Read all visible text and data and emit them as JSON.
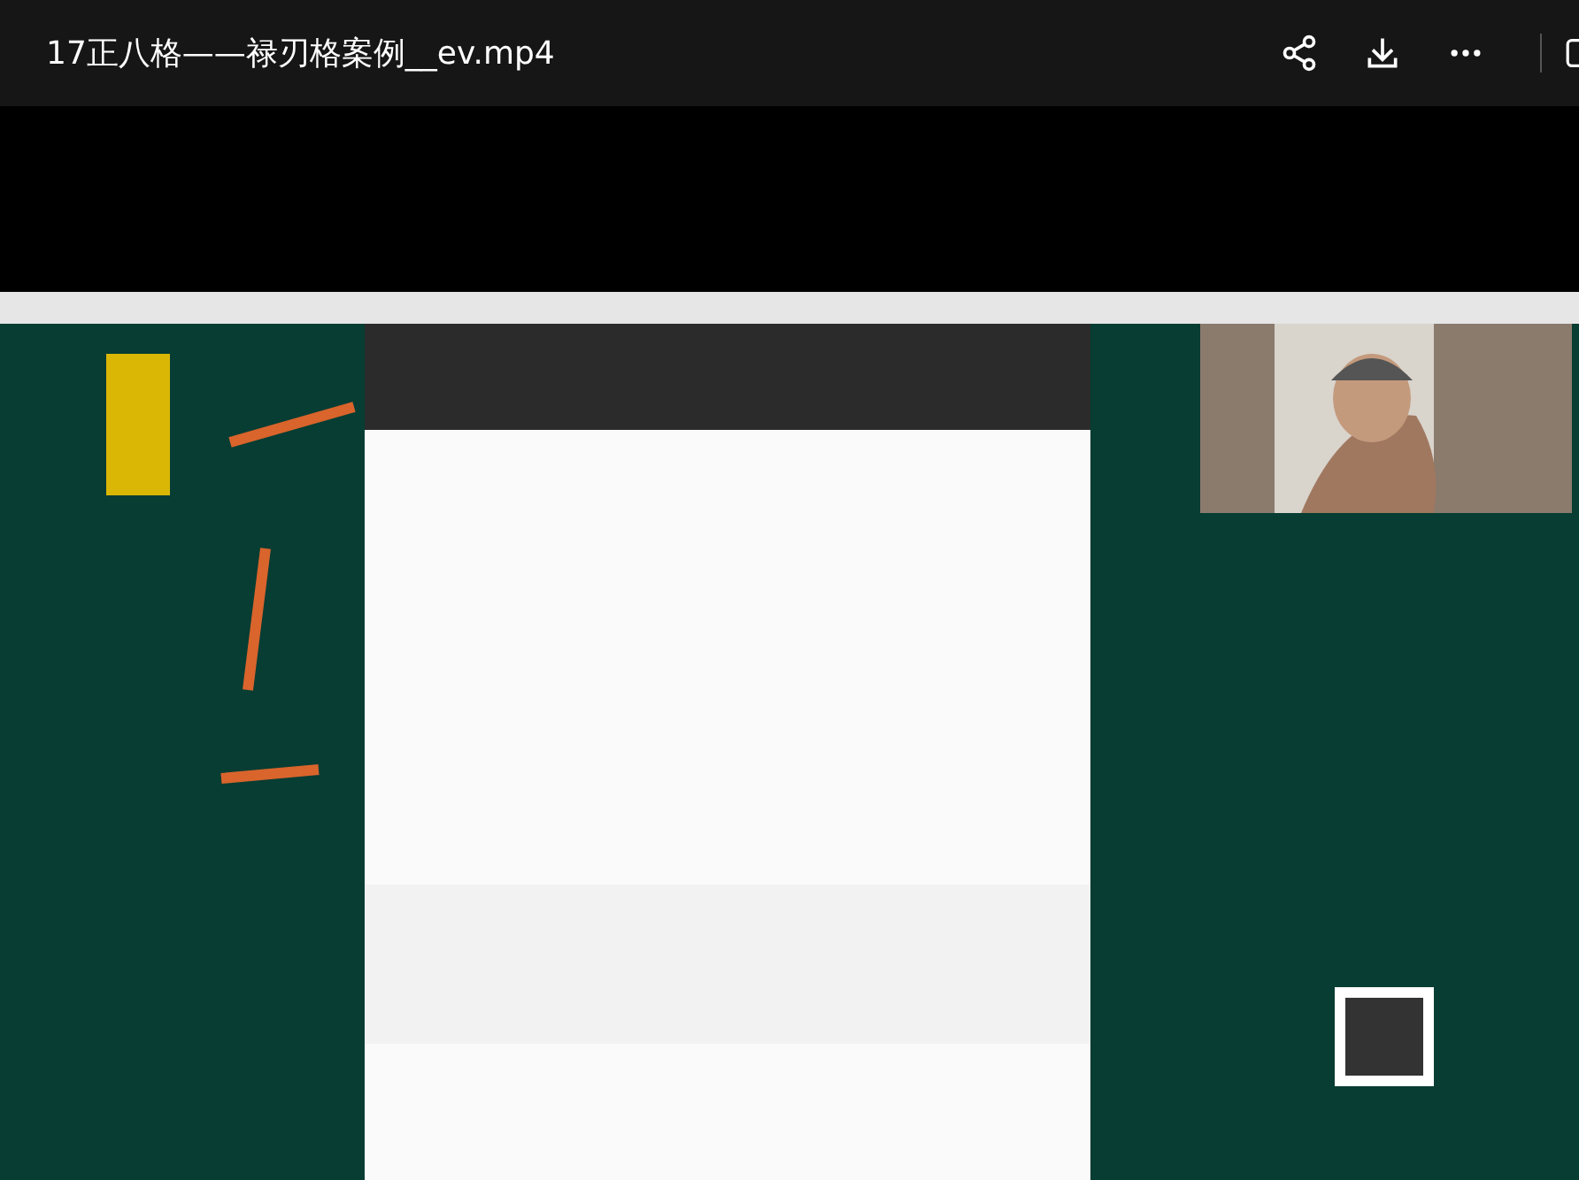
{
  "window": {
    "title": "17正八格——禄刃格案例__ev.mp4"
  }
}
